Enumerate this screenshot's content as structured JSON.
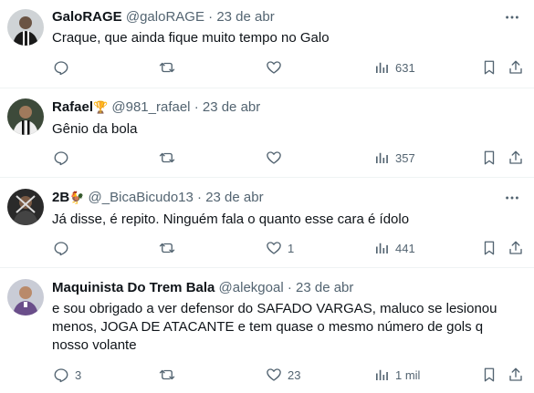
{
  "tweets": [
    {
      "name": "GaloRAGE",
      "badge": "",
      "handle": "@galoRAGE",
      "date": "23 de abr",
      "text": "Craque, que ainda fique muito tempo no Galo",
      "replies": "",
      "retweets": "",
      "likes": "",
      "views": "631"
    },
    {
      "name": "Rafael",
      "badge": "🏆",
      "handle": "@981_rafael",
      "date": "23 de abr",
      "text": "Gênio da bola",
      "replies": "",
      "retweets": "",
      "likes": "",
      "views": "357"
    },
    {
      "name": "2B",
      "badge": "🐓",
      "handle": "@_BicaBicudo13",
      "date": "23 de abr",
      "text": "Já disse, é repito. Ninguém fala o quanto esse cara é ídolo",
      "replies": "",
      "retweets": "",
      "likes": "1",
      "views": "441"
    },
    {
      "name": "Maquinista Do Trem Bala",
      "badge": "",
      "handle": "@alekgoal",
      "date": "23 de abr",
      "text": "e sou obrigado a ver defensor do SAFADO VARGAS, maluco se lesionou menos, JOGA DE ATACANTE e tem quase o mesmo número de gols q nosso volante",
      "replies": "3",
      "retweets": "",
      "likes": "23",
      "views": "1 mil"
    }
  ],
  "separator": "·",
  "icons": [
    "reply-icon",
    "retweet-icon",
    "like-icon",
    "views-icon",
    "bookmark-icon",
    "share-icon",
    "more-icon"
  ],
  "colors": {
    "text": "#0f1419",
    "secondary": "#536471",
    "divider": "#eff3f4"
  }
}
